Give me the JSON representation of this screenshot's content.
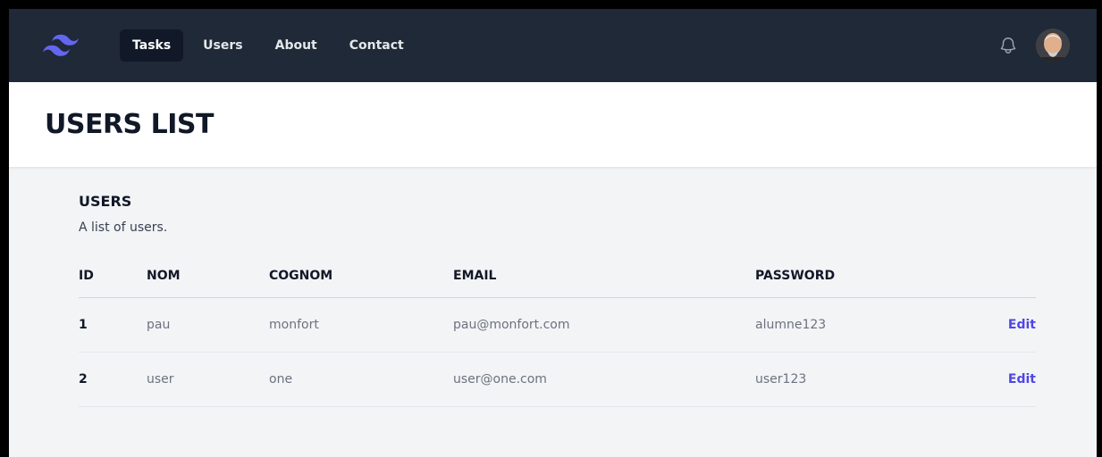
{
  "nav": {
    "logo_icon": "tailwind-logo-icon",
    "items": [
      {
        "label": "Tasks",
        "active": true
      },
      {
        "label": "Users",
        "active": false
      },
      {
        "label": "About",
        "active": false
      },
      {
        "label": "Contact",
        "active": false
      }
    ],
    "bell_icon": "bell-icon",
    "avatar_icon": "user-avatar"
  },
  "header": {
    "title": "USERS LIST"
  },
  "section": {
    "title": "USERS",
    "description": "A list of users."
  },
  "table": {
    "columns": [
      "ID",
      "NOM",
      "COGNOM",
      "EMAIL",
      "PASSWORD",
      ""
    ],
    "rows": [
      {
        "id": "1",
        "nom": "pau",
        "cognom": "monfort",
        "email": "pau@monfort.com",
        "password": "alumne123",
        "action": "Edit"
      },
      {
        "id": "2",
        "nom": "user",
        "cognom": "one",
        "email": "user@one.com",
        "password": "user123",
        "action": "Edit"
      }
    ]
  },
  "colors": {
    "navbar_bg": "#1f2937",
    "active_tab_bg": "#111827",
    "page_bg": "#f3f4f6",
    "link_accent": "#4f46e5",
    "logo_accent": "#6366f1"
  }
}
